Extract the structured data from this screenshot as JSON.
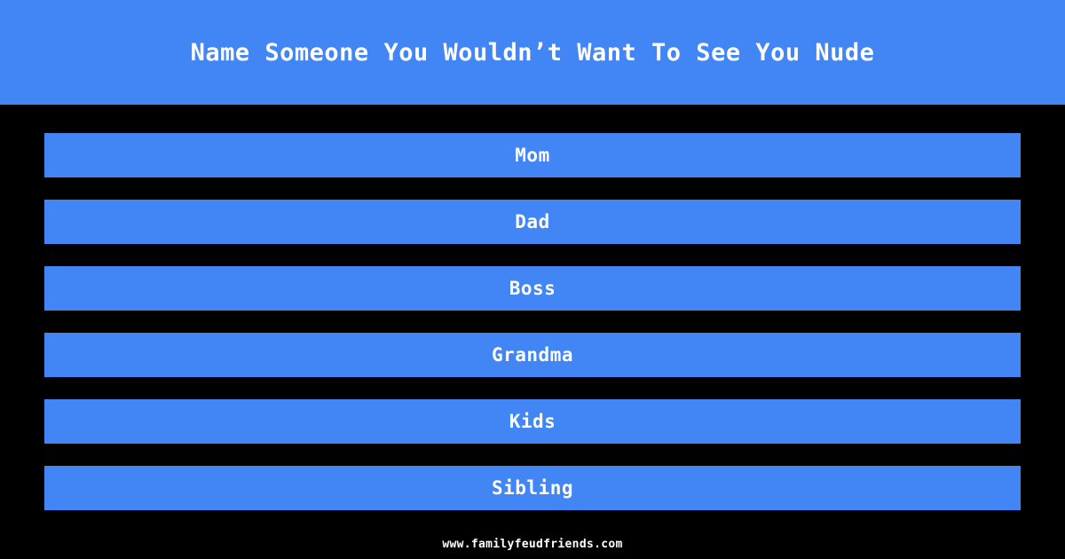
{
  "theme": {
    "background_color": "#000000",
    "accent_color": "#4285f4",
    "text_color": "#ffffff"
  },
  "header": {
    "question": "Name Someone You Wouldn’t Want To See You Nude"
  },
  "answers": [
    {
      "text": "Mom"
    },
    {
      "text": "Dad"
    },
    {
      "text": "Boss"
    },
    {
      "text": "Grandma"
    },
    {
      "text": "Kids"
    },
    {
      "text": "Sibling"
    }
  ],
  "footer": {
    "site_url": "www.familyfeudfriends.com"
  }
}
